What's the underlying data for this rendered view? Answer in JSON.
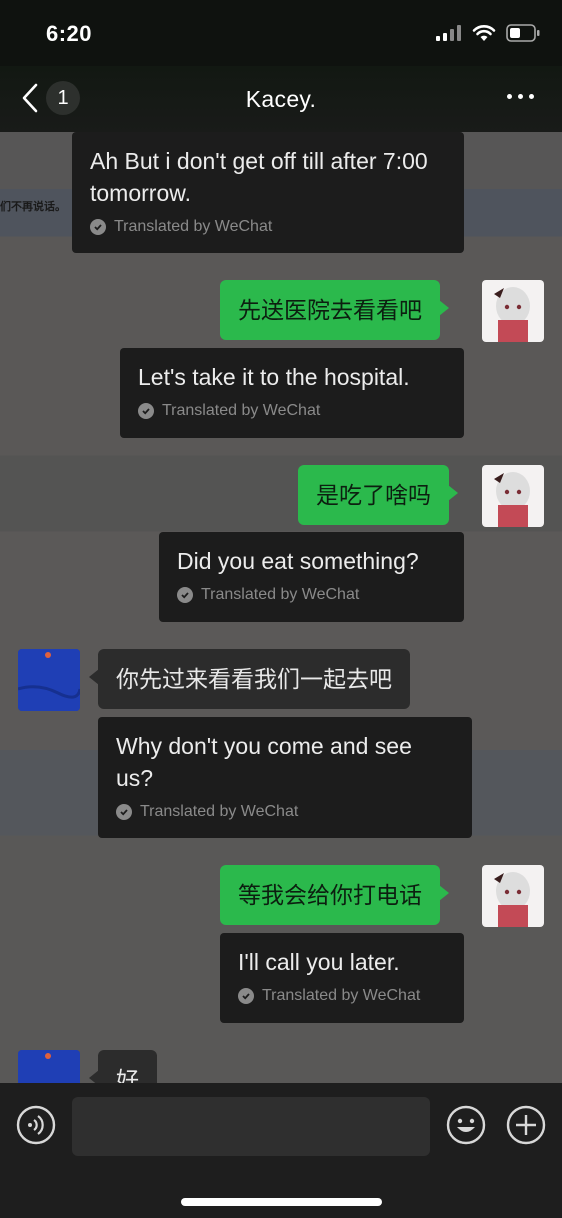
{
  "status": {
    "time": "6:20"
  },
  "nav": {
    "back_count": "1",
    "title": "Kacey."
  },
  "background": {
    "text": "们不再说话。"
  },
  "messages": {
    "m1": {
      "translation": "Ah But i don't get off till after 7:00 tomorrow.",
      "label": "Translated by WeChat"
    },
    "m2": {
      "text": "先送医院去看看吧",
      "translation": "Let's take it to the hospital.",
      "label": "Translated by WeChat"
    },
    "m3": {
      "text": "是吃了啥吗",
      "translation": "Did you eat something?",
      "label": "Translated by WeChat"
    },
    "m4": {
      "text": "你先过来看看我们一起去吧",
      "translation": "Why don't you come and see us?",
      "label": "Translated by WeChat"
    },
    "m5": {
      "text": "等我会给你打电话",
      "translation": "I'll call you later.",
      "label": "Translated by WeChat"
    },
    "m6": {
      "text": "好"
    }
  },
  "icons": [
    "back-icon",
    "signal-icon",
    "wifi-icon",
    "battery-icon",
    "more-icon",
    "check-icon",
    "voice-icon",
    "emoji-icon",
    "plus-icon"
  ],
  "colors": {
    "sent_bubble": "#2bb94c",
    "received_bubble": "#2c2c2c",
    "translation_bubble": "#1c1c1c"
  }
}
